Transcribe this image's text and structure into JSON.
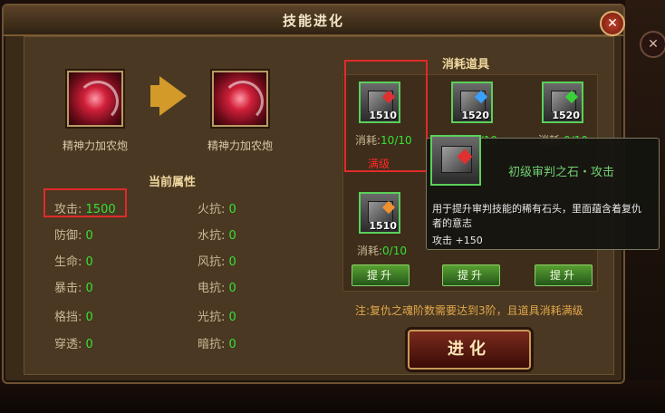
{
  "window": {
    "title": "技能进化",
    "close": "✕"
  },
  "background": {
    "close": "✕"
  },
  "skills": {
    "current_name": "精神力加农炮",
    "next_name": "精神力加农炮"
  },
  "attributes": {
    "title": "当前属性",
    "left": [
      {
        "label": "攻击:",
        "value": "1500"
      },
      {
        "label": "防御:",
        "value": "0"
      },
      {
        "label": "生命:",
        "value": "0"
      },
      {
        "label": "暴击:",
        "value": "0"
      },
      {
        "label": "格挡:",
        "value": "0"
      },
      {
        "label": "穿透:",
        "value": "0"
      }
    ],
    "right": [
      {
        "label": "火抗:",
        "value": "0"
      },
      {
        "label": "水抗:",
        "value": "0"
      },
      {
        "label": "风抗:",
        "value": "0"
      },
      {
        "label": "电抗:",
        "value": "0"
      },
      {
        "label": "光抗:",
        "value": "0"
      },
      {
        "label": "暗抗:",
        "value": "0"
      }
    ]
  },
  "consumables": {
    "title": "消耗道具",
    "consume_label": "消耗:",
    "items": [
      {
        "count": "1510",
        "consume": "10/10",
        "status": "满级",
        "gem_color": "#e03030"
      },
      {
        "count": "1520",
        "consume": "0/10",
        "gem_color": "#3aa0ff"
      },
      {
        "count": "1520",
        "consume": "0/10",
        "gem_color": "#3ad03a"
      },
      {
        "count": "1510",
        "consume": "0/10",
        "gem_color": "#f09030"
      }
    ],
    "upgrade_labels": [
      "提升",
      "提升",
      "提升"
    ]
  },
  "note": "注:复仇之魂阶数需要达到3阶，且道具消耗满级",
  "evolve_button": "进化",
  "tooltip": {
    "name": "初级审判之石・攻击",
    "desc": "用于提升审判技能的稀有石头，里面蕴含着复仇者的意志",
    "stat": "攻击 +150"
  }
}
